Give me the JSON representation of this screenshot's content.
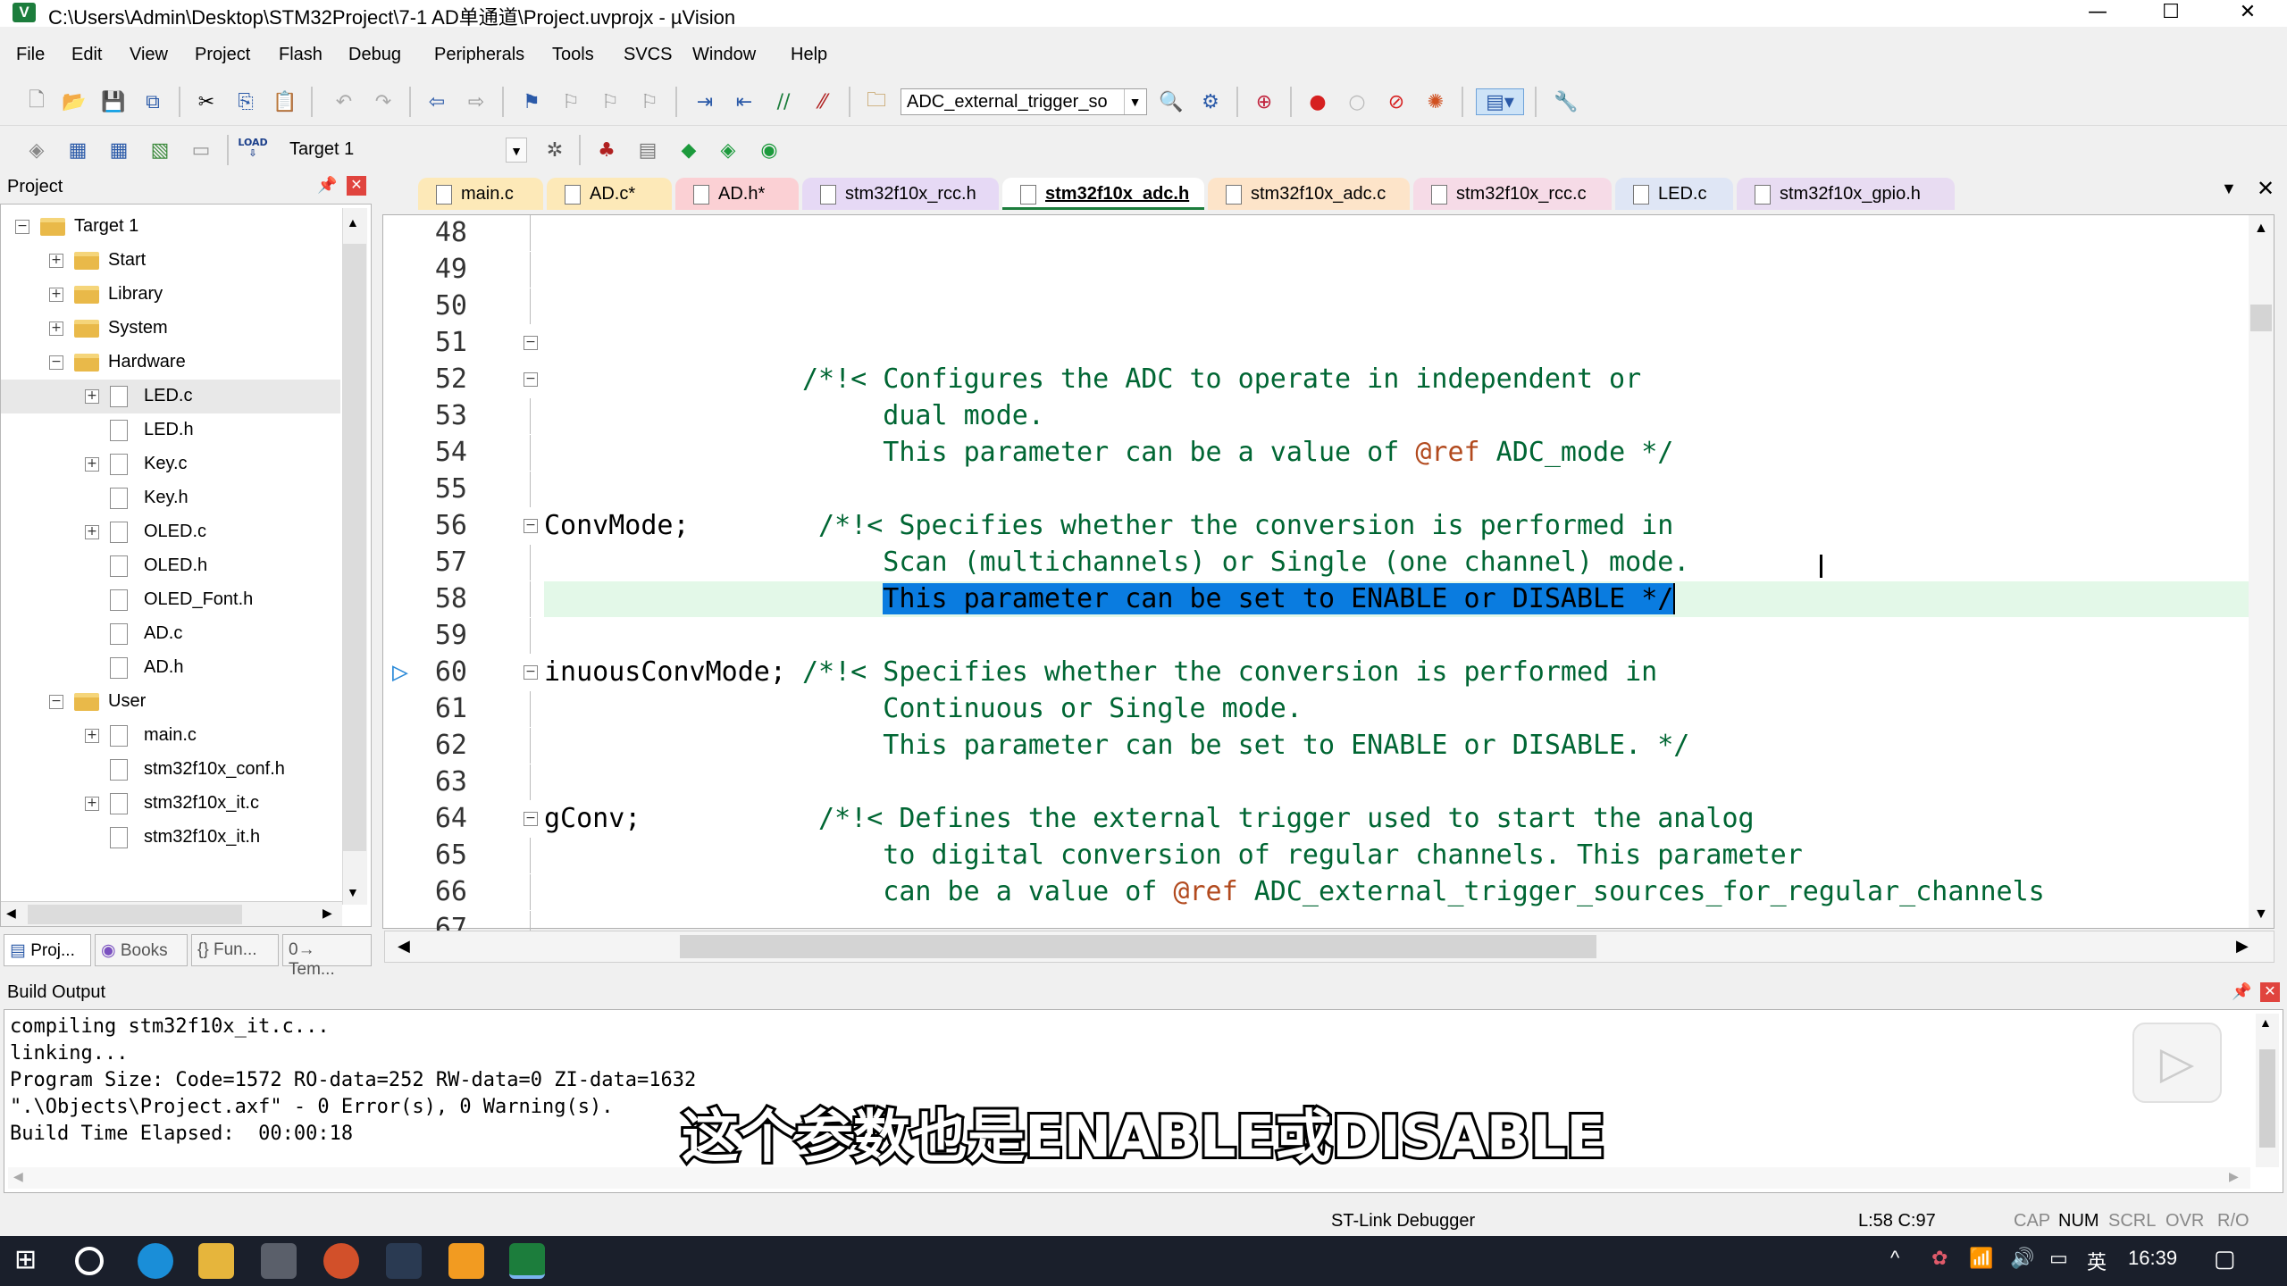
{
  "window": {
    "title": "C:\\Users\\Admin\\Desktop\\STM32Project\\7-1 AD单通道\\Project.uvprojx - µVision",
    "minimize": "—",
    "maximize": "☐",
    "close": "✕"
  },
  "menu": [
    "File",
    "Edit",
    "View",
    "Project",
    "Flash",
    "Debug",
    "Peripherals",
    "Tools",
    "SVCS",
    "Window",
    "Help"
  ],
  "toolbar": {
    "find_combo_value": "ADC_external_trigger_so",
    "target_combo_value": "Target 1",
    "load_label": "LOAD"
  },
  "project_panel": {
    "title": "Project",
    "tree": [
      {
        "label": "Target 1",
        "kind": "target",
        "level": 0,
        "expanded": true
      },
      {
        "label": "Start",
        "kind": "folder",
        "level": 1,
        "expanded": false
      },
      {
        "label": "Library",
        "kind": "folder",
        "level": 1,
        "expanded": false
      },
      {
        "label": "System",
        "kind": "folder",
        "level": 1,
        "expanded": false
      },
      {
        "label": "Hardware",
        "kind": "folder",
        "level": 1,
        "expanded": true
      },
      {
        "label": "LED.c",
        "kind": "file",
        "level": 2,
        "expandable": true
      },
      {
        "label": "LED.h",
        "kind": "file",
        "level": 2,
        "expandable": false
      },
      {
        "label": "Key.c",
        "kind": "file",
        "level": 2,
        "expandable": true
      },
      {
        "label": "Key.h",
        "kind": "file",
        "level": 2,
        "expandable": false
      },
      {
        "label": "OLED.c",
        "kind": "file",
        "level": 2,
        "expandable": true
      },
      {
        "label": "OLED.h",
        "kind": "file",
        "level": 2,
        "expandable": false
      },
      {
        "label": "OLED_Font.h",
        "kind": "file",
        "level": 2,
        "expandable": false
      },
      {
        "label": "AD.c",
        "kind": "file",
        "level": 2,
        "expandable": false
      },
      {
        "label": "AD.h",
        "kind": "file",
        "level": 2,
        "expandable": false
      },
      {
        "label": "User",
        "kind": "folder",
        "level": 1,
        "expanded": true
      },
      {
        "label": "main.c",
        "kind": "file",
        "level": 2,
        "expandable": true
      },
      {
        "label": "stm32f10x_conf.h",
        "kind": "file",
        "level": 2,
        "expandable": false
      },
      {
        "label": "stm32f10x_it.c",
        "kind": "file",
        "level": 2,
        "expandable": true
      },
      {
        "label": "stm32f10x_it.h",
        "kind": "file",
        "level": 2,
        "expandable": false
      }
    ],
    "bottom_tabs": [
      "Proj...",
      "Books",
      "{} Fun...",
      "0→ Tem..."
    ]
  },
  "editor": {
    "tabs": [
      {
        "label": "main.c",
        "color": "#fde9b8",
        "active": false
      },
      {
        "label": "AD.c*",
        "color": "#fde9b8",
        "active": false
      },
      {
        "label": "AD.h*",
        "color": "#fbd0d4",
        "active": false
      },
      {
        "label": "stm32f10x_rcc.h",
        "color": "#e6d9f5",
        "active": false
      },
      {
        "label": "stm32f10x_adc.h",
        "color": "#d8f0e8",
        "active": true
      },
      {
        "label": "stm32f10x_adc.c",
        "color": "#fde4c9",
        "active": false
      },
      {
        "label": "stm32f10x_rcc.c",
        "color": "#f6dbe7",
        "active": false
      },
      {
        "label": "LED.c",
        "color": "#dfe6f5",
        "active": false
      },
      {
        "label": "stm32f10x_gpio.h",
        "color": "#e8dcf2",
        "active": false
      }
    ],
    "lines": [
      {
        "no": "48",
        "code": "",
        "comment": ""
      },
      {
        "no": "49",
        "code": "",
        "comment": ""
      },
      {
        "no": "50",
        "code": "",
        "comment": ""
      },
      {
        "no": "51",
        "code": "",
        "comment": "",
        "fold": true
      },
      {
        "no": "52",
        "code": "                ",
        "comment": "/*!< Configures the ADC to operate in independent or",
        "fold": true
      },
      {
        "no": "53",
        "code": "",
        "comment": "                     dual mode."
      },
      {
        "no": "54",
        "code": "",
        "comment": "                     This parameter can be a value of ",
        "ref": "@ref",
        "tail": " ADC_mode */"
      },
      {
        "no": "55",
        "code": "",
        "comment": ""
      },
      {
        "no": "56",
        "code": "ConvMode;        ",
        "comment": "/*!< Specifies whether the conversion is performed in",
        "fold": true
      },
      {
        "no": "57",
        "code": "",
        "comment": "                     Scan (multichannels) or Single (one channel) mode."
      },
      {
        "no": "58",
        "code": "",
        "comment": "This parameter can be set to ENABLE or DISABLE */",
        "selected": true
      },
      {
        "no": "59",
        "code": "",
        "comment": ""
      },
      {
        "no": "60",
        "code": "inuousConvMode; ",
        "comment": "/*!< Specifies whether the conversion is performed in",
        "fold": true,
        "marker": true
      },
      {
        "no": "61",
        "code": "",
        "comment": "                     Continuous or Single mode."
      },
      {
        "no": "62",
        "code": "",
        "comment": "                     This parameter can be set to ENABLE or DISABLE. */"
      },
      {
        "no": "63",
        "code": "",
        "comment": ""
      },
      {
        "no": "64",
        "code": "gConv;           ",
        "comment": "/*!< Defines the external trigger used to start the analog",
        "fold": true
      },
      {
        "no": "65",
        "code": "",
        "comment": "                     to digital conversion of regular channels. This parameter"
      },
      {
        "no": "66",
        "code": "",
        "comment": "                     can be a value of ",
        "ref": "@ref",
        "tail": " ADC_external_trigger_sources_for_regular_channels"
      },
      {
        "no": "67",
        "code": "",
        "comment": ""
      }
    ]
  },
  "build_output": {
    "title": "Build Output",
    "lines": [
      "compiling stm32f10x_it.c...",
      "linking...",
      "Program Size: Code=1572 RO-data=252 RW-data=0 ZI-data=1632",
      "\".\\Objects\\Project.axf\" - 0 Error(s), 0 Warning(s).",
      "Build Time Elapsed:  00:00:18"
    ]
  },
  "subtitle": "这个参数也是ENABLE或DISABLE",
  "statusbar": {
    "debugger": "ST-Link Debugger",
    "position": "L:58 C:97",
    "flags": [
      "CAP",
      "NUM",
      "SCRL",
      "OVR",
      "R/O"
    ]
  },
  "taskbar": {
    "clock": "16:39",
    "ime": "英"
  },
  "colors": {
    "comment": "#006633",
    "selection": "#0a7ce0",
    "current_line": "#e3f8e8",
    "taskbar": "#1a1f2b"
  }
}
